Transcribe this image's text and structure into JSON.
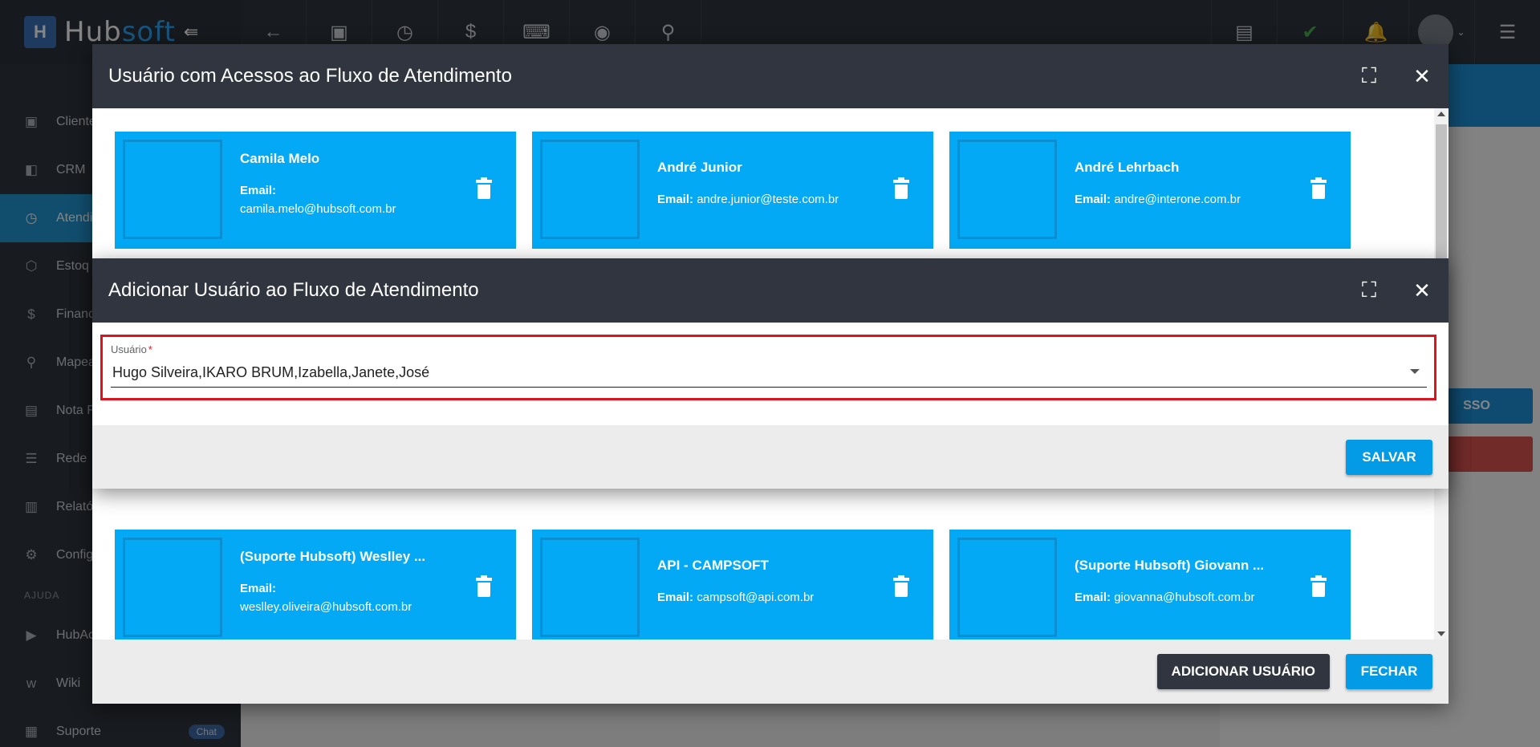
{
  "app": {
    "brand_first": "Hub",
    "brand_second": "soft",
    "collapse_glyph": "⇚"
  },
  "sidebar": {
    "items": [
      {
        "label": "Cliente",
        "icon": "id-card-icon"
      },
      {
        "label": "CRM",
        "icon": "crm-board-icon"
      },
      {
        "label": "Atendi",
        "icon": "calendar-clock-icon"
      },
      {
        "label": "Estoq",
        "icon": "box-icon"
      },
      {
        "label": "Financ",
        "icon": "money-icon"
      },
      {
        "label": "Mapea",
        "icon": "map-pin-icon"
      },
      {
        "label": "Nota F",
        "icon": "document-icon"
      },
      {
        "label": "Rede",
        "icon": "server-icon"
      },
      {
        "label": "Relató",
        "icon": "report-icon"
      },
      {
        "label": "Config",
        "icon": "gear-icon"
      }
    ],
    "section_label": "AJUDA",
    "help_items": [
      {
        "label": "HubAc",
        "icon": "youtube-icon"
      },
      {
        "label": "Wiki",
        "icon": "wiki-icon"
      },
      {
        "label": "Suporte",
        "icon": "chat-icon",
        "badge": "Chat"
      }
    ]
  },
  "background": {
    "button_label": "SSO"
  },
  "dialog_main": {
    "title": "Usuário com Acessos ao Fluxo de Atendimento",
    "cards_top": [
      {
        "name": "Camila Melo",
        "email_label": "Email:",
        "email": "camila.melo@hubsoft.com.br"
      },
      {
        "name": "André Junior",
        "email_label": "Email:",
        "email": "andre.junior@teste.com.br"
      },
      {
        "name": "André Lehrbach",
        "email_label": "Email:",
        "email": "andre@interone.com.br"
      }
    ],
    "cards_bottom": [
      {
        "name": "(Suporte Hubsoft) Weslley ...",
        "email_label": "Email:",
        "email": "weslley.oliveira@hubsoft.com.br"
      },
      {
        "name": "API - CAMPSOFT",
        "email_label": "Email:",
        "email": "campsoft@api.com.br"
      },
      {
        "name": "(Suporte Hubsoft) Giovann ...",
        "email_label": "Email:",
        "email": "giovanna@hubsoft.com.br"
      }
    ],
    "add_user_label": "ADICIONAR USUÁRIO",
    "close_label": "FECHAR"
  },
  "dialog_add": {
    "title": "Adicionar Usuário ao Fluxo de Atendimento",
    "field_label": "Usuário",
    "required_mark": "*",
    "field_value": "Hugo Silveira,IKARO BRUM,Izabella,Janete,José",
    "save_label": "SALVAR"
  },
  "colors": {
    "card_bg": "#03a9f4",
    "header_bg": "#31353f",
    "highlight_border": "#e0121c",
    "primary_button": "#039be5"
  }
}
